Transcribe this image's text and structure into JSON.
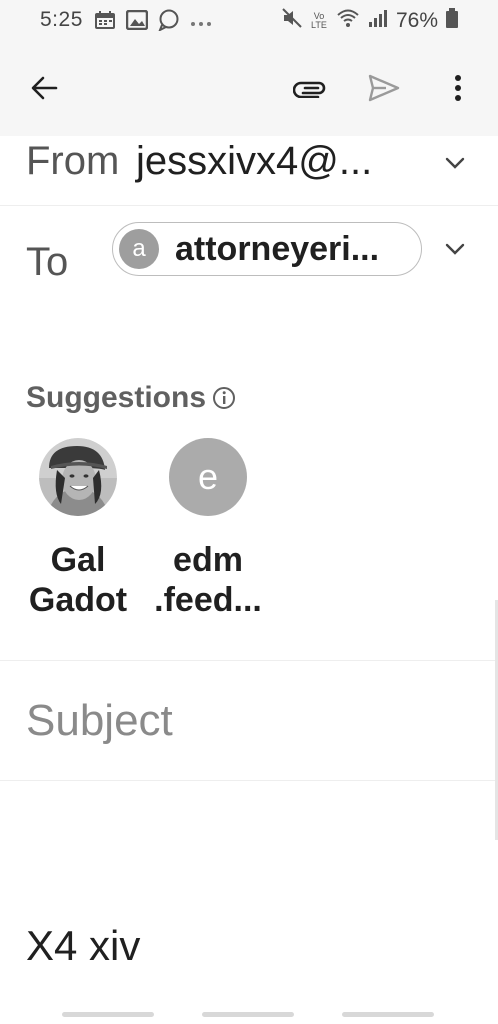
{
  "status_bar": {
    "time": "5:25",
    "battery": "76%",
    "left_icons": [
      "calendar-icon",
      "image-icon",
      "chat-bubble-icon",
      "more-dots-icon"
    ],
    "right_icons": [
      "mute-icon",
      "volte-icon",
      "wifi-icon",
      "signal-icon",
      "battery-icon"
    ],
    "volte_label": "Vo LTE"
  },
  "toolbar": {
    "back_icon": "arrow-left-icon",
    "attach_icon": "paperclip-icon",
    "send_icon": "send-icon",
    "menu_icon": "more-vert-icon"
  },
  "compose": {
    "from_label": "From",
    "from_value": "jessxivx4@...",
    "to_label": "To",
    "to_chip": {
      "avatar_letter": "a",
      "text": "attorneyeri..."
    },
    "suggestions_title": "Suggestions",
    "suggestions": [
      {
        "name_line1": "Gal",
        "name_line2": "Gadot",
        "avatar": "photo"
      },
      {
        "name_line1": "edm",
        "name_line2": ".feed...",
        "avatar_letter": "e"
      }
    ],
    "subject_placeholder": "Subject",
    "body": "X4 xiv"
  },
  "colors": {
    "bar_bg": "#f6f6f6",
    "chip_avatar": "#9e9e9e",
    "suggestion_avatar": "#ababab"
  }
}
